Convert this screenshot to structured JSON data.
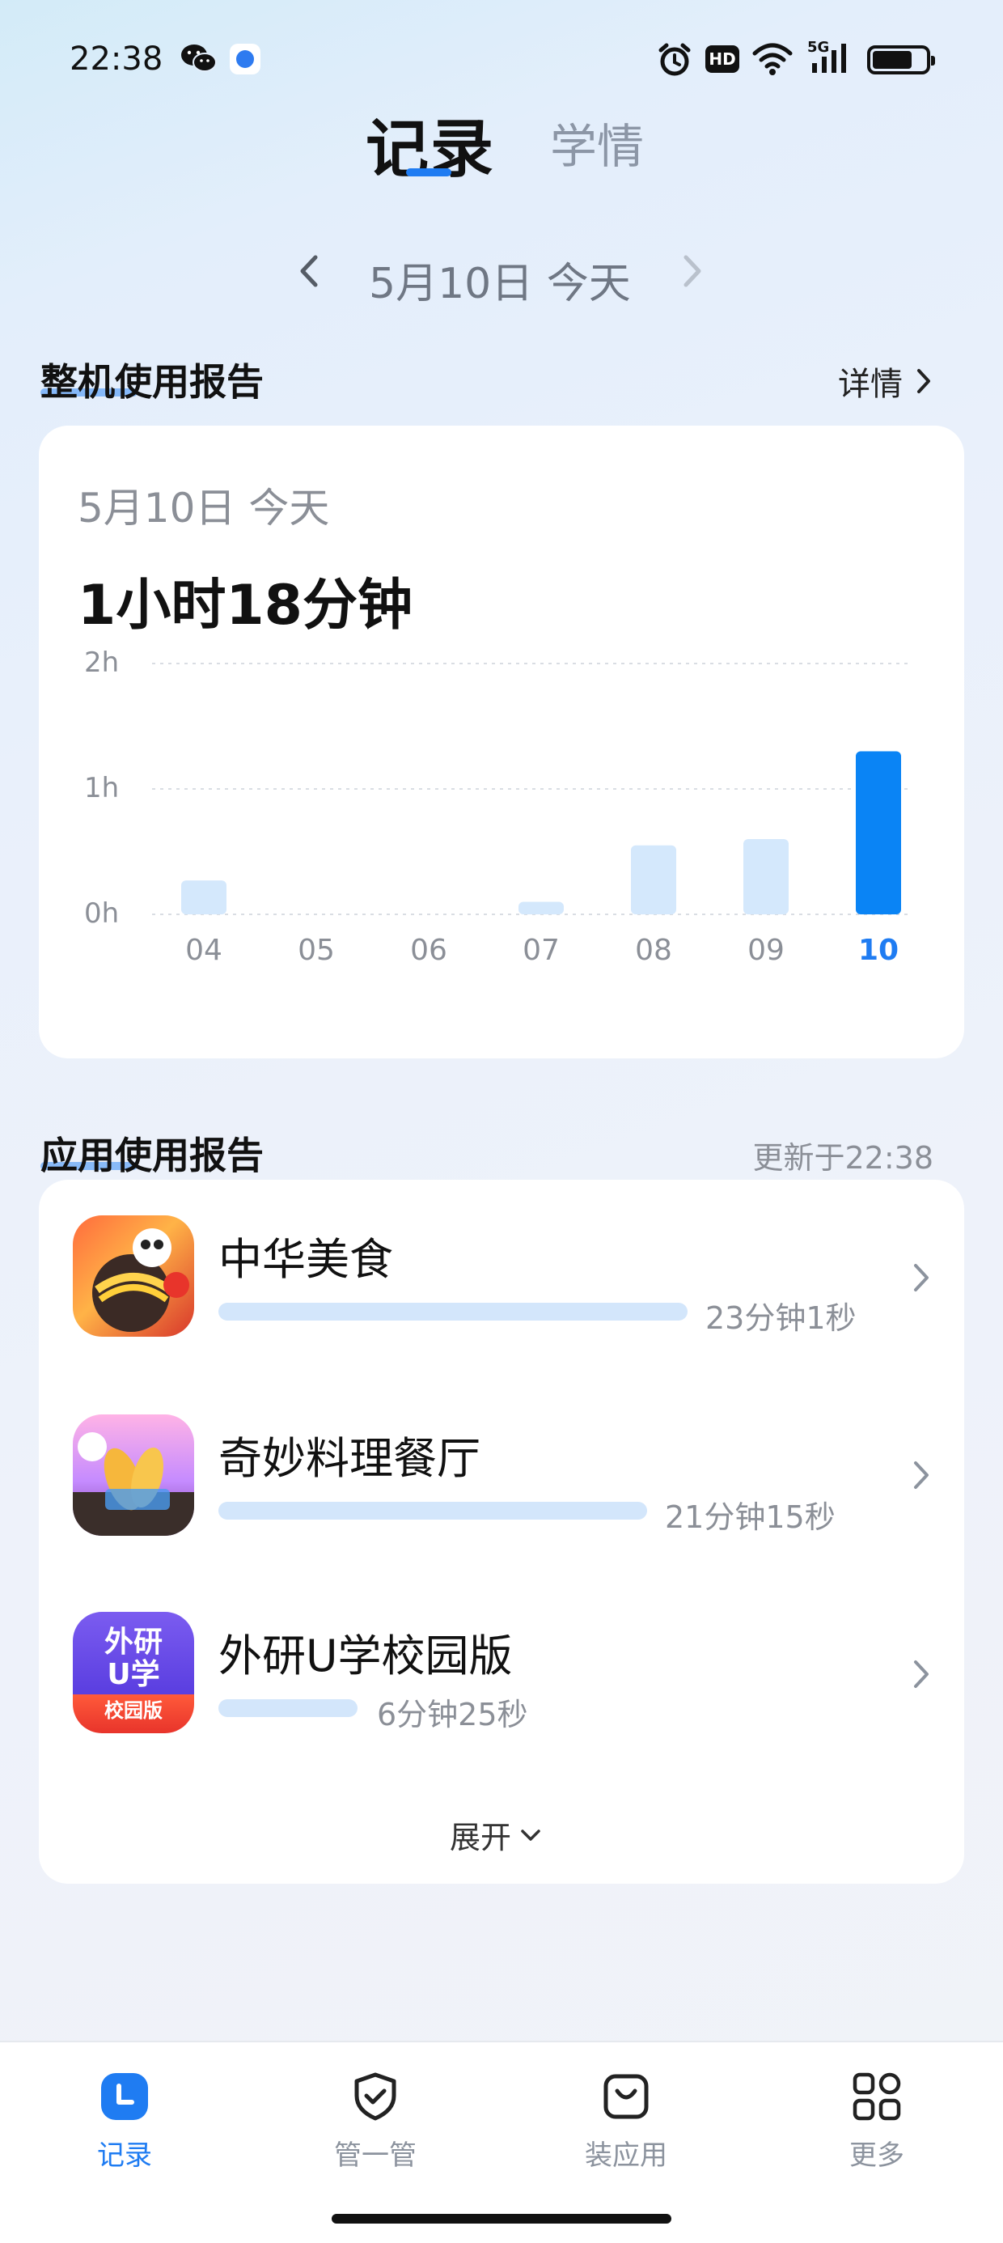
{
  "status_bar": {
    "time": "22:38",
    "icons": [
      "wechat-icon",
      "app-notification-icon",
      "alarm-icon",
      "hd-icon",
      "wifi-icon",
      "5g-signal-icon",
      "battery-icon"
    ],
    "hd": "HD",
    "network": "5G"
  },
  "top_tabs": [
    {
      "label": "记录",
      "active": true
    },
    {
      "label": "学情",
      "active": false
    }
  ],
  "date_nav": {
    "label": "5月10日 今天"
  },
  "device_report": {
    "title": "整机使用报告",
    "details_label": "详情",
    "card_date": "5月10日 今天",
    "total": "1小时18分钟"
  },
  "chart_data": {
    "type": "bar",
    "categories": [
      "04",
      "05",
      "06",
      "07",
      "08",
      "09",
      "10"
    ],
    "values": [
      0.27,
      0,
      0,
      0.1,
      0.55,
      0.6,
      1.3
    ],
    "unit": "h",
    "y_ticks": [
      "0h",
      "1h",
      "2h"
    ],
    "ylim": [
      0,
      2
    ],
    "highlight_index": 6,
    "colors": {
      "bar": "#d4e8fc",
      "highlight": "#0a84f5",
      "highlight_label": "#1f7cf2"
    }
  },
  "app_report": {
    "title": "应用使用报告",
    "updated": "更新于22:38",
    "apps": [
      {
        "name": "中华美食",
        "time": "23分钟1秒",
        "fraction": 1.0
      },
      {
        "name": "奇妙料理餐厅",
        "time": "21分钟15秒",
        "fraction": 0.92
      },
      {
        "name": "外研U学校园版",
        "time": "6分钟25秒",
        "fraction": 0.3
      }
    ],
    "icon3_text": {
      "line1": "外研",
      "line2": "U学",
      "line3": "校园版"
    },
    "expand_label": "展开"
  },
  "bottom_nav": [
    {
      "label": "记录",
      "icon": "record-clock-icon",
      "active": true
    },
    {
      "label": "管一管",
      "icon": "shield-check-icon",
      "active": false
    },
    {
      "label": "装应用",
      "icon": "app-store-bag-icon",
      "active": false
    },
    {
      "label": "更多",
      "icon": "grid-more-icon",
      "active": false
    }
  ],
  "colors": {
    "accent": "#1f7cf2",
    "muted": "#8b8f97"
  }
}
